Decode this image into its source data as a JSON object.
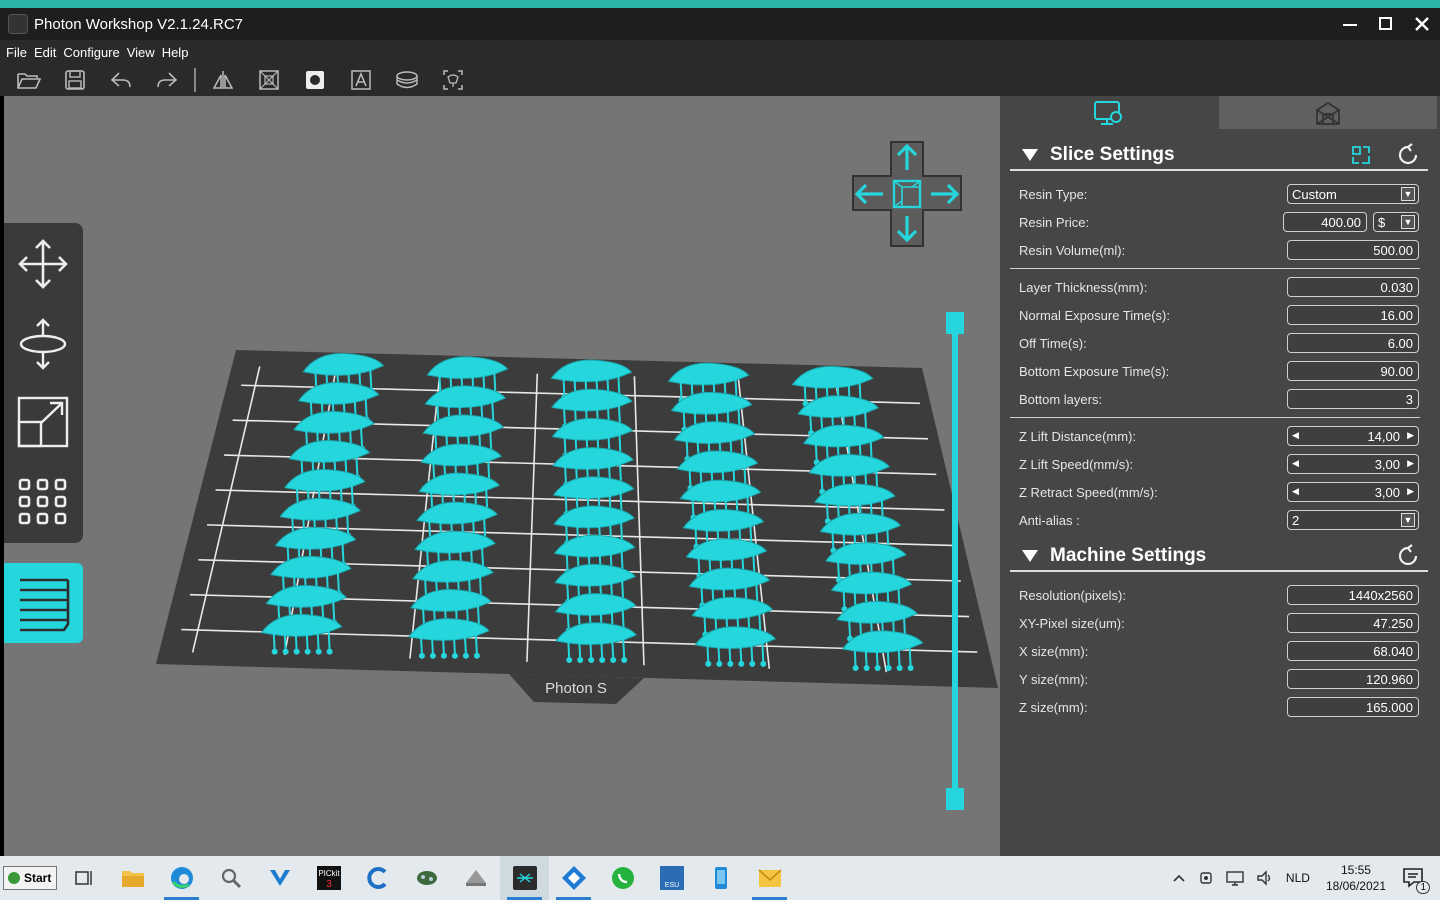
{
  "window": {
    "title": "Photon Workshop V2.1.24.RC7",
    "controls": {
      "minimize": "—",
      "maximize": "☐",
      "close": "✕"
    }
  },
  "menu": [
    "File",
    "Edit",
    "Configure",
    "View",
    "Help"
  ],
  "toolbar_icons": [
    "open-folder-icon",
    "save-icon",
    "undo-icon",
    "redo-icon",
    "mirror-icon",
    "hollow-icon",
    "punch-hole-icon",
    "text-icon",
    "slice-icon",
    "supports-icon"
  ],
  "left_tools": [
    "move-icon",
    "rotate-icon",
    "scale-icon",
    "array-icon",
    "layers-icon"
  ],
  "viewport": {
    "plate_label": "Photon S",
    "model_color": "#25d6dd",
    "plate_color": "#3c3c3c",
    "background": "#757575"
  },
  "panel": {
    "slice": {
      "title": "Slice Settings",
      "resin_type": {
        "label": "Resin Type:",
        "value": "Custom"
      },
      "resin_price": {
        "label": "Resin Price:",
        "value": "400.00",
        "currency": "$"
      },
      "resin_volume": {
        "label": "Resin Volume(ml):",
        "value": "500.00"
      },
      "layer_thickness": {
        "label": "Layer Thickness(mm):",
        "value": "0.030"
      },
      "normal_exposure": {
        "label": "Normal Exposure Time(s):",
        "value": "16.00"
      },
      "off_time": {
        "label": "Off Time(s):",
        "value": "6.00"
      },
      "bottom_exposure": {
        "label": "Bottom Exposure Time(s):",
        "value": "90.00"
      },
      "bottom_layers": {
        "label": "Bottom layers:",
        "value": "3"
      },
      "z_lift_distance": {
        "label": "Z Lift Distance(mm):",
        "value": "14,00"
      },
      "z_lift_speed": {
        "label": "Z Lift Speed(mm/s):",
        "value": "3,00"
      },
      "z_retract_speed": {
        "label": "Z Retract Speed(mm/s):",
        "value": "3,00"
      },
      "anti_alias": {
        "label": "Anti-alias :",
        "value": "2"
      }
    },
    "machine": {
      "title": "Machine Settings",
      "resolution": {
        "label": "Resolution(pixels):",
        "value": "1440x2560"
      },
      "xy_pixel": {
        "label": "XY-Pixel size(um):",
        "value": "47.250"
      },
      "x_size": {
        "label": "X size(mm):",
        "value": "68.040"
      },
      "y_size": {
        "label": "Y size(mm):",
        "value": "120.960"
      },
      "z_size": {
        "label": "Z size(mm):",
        "value": "165.000"
      }
    }
  },
  "taskbar": {
    "start_label": "Start",
    "apps": [
      "task-view-icon",
      "file-explorer-icon",
      "edge-icon",
      "search-icon",
      "vs-code-icon",
      "pickit-icon",
      "c-app-icon",
      "circuit-icon",
      "cad-icon",
      "photon-workshop-icon",
      "app-blue-icon",
      "whatsapp-icon",
      "esu-icon",
      "phone-icon",
      "mail-icon"
    ],
    "pickit_label": "PICkit",
    "pickit_num": "3",
    "esu_label": "ESU",
    "language": "NLD",
    "time": "15:55",
    "date": "18/06/2021",
    "notification_count": "1"
  }
}
